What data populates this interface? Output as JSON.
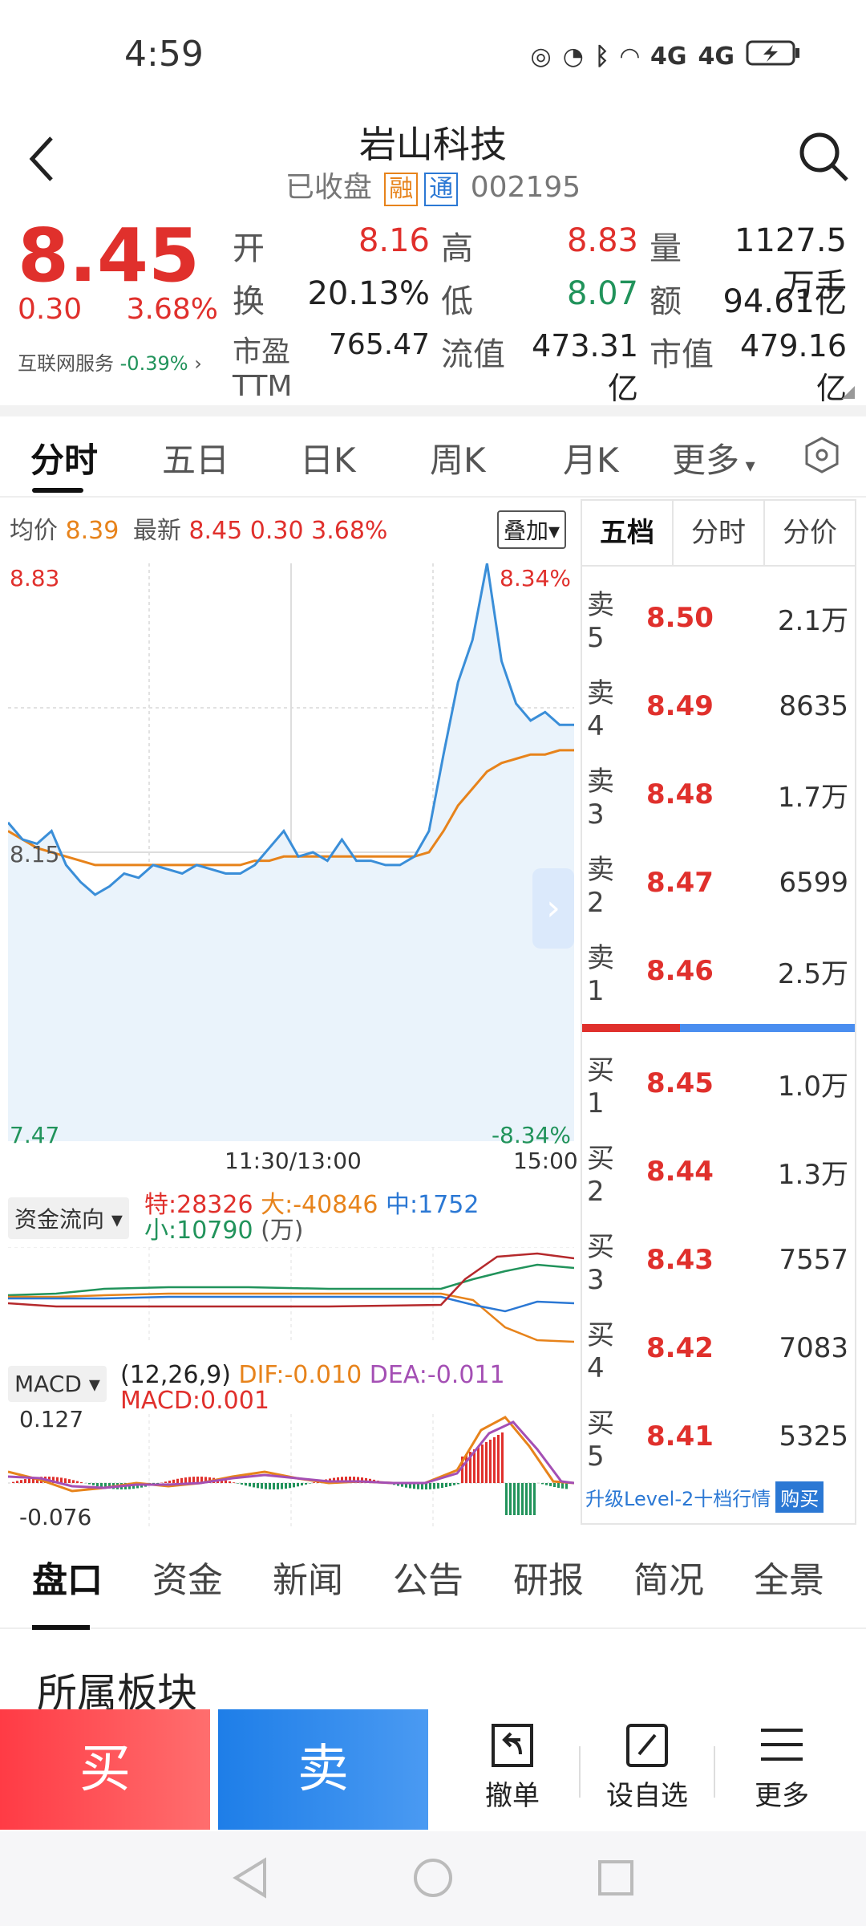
{
  "status": {
    "time": "4:59",
    "net1": "4G",
    "net2": "4G"
  },
  "header": {
    "title": "岩山科技",
    "state": "已收盘",
    "tag1": "融",
    "tag2": "通",
    "code": "002195"
  },
  "quote": {
    "price": "8.45",
    "change": "0.30",
    "change_pct": "3.68%",
    "sector_label": "互联网服务",
    "sector_pct": "-0.39%",
    "fields": [
      [
        {
          "label": "开",
          "value": "8.16",
          "color": "red"
        },
        {
          "label": "高",
          "value": "8.83",
          "color": "red"
        },
        {
          "label": "量",
          "value": "1127.5万手",
          "color": "dark"
        }
      ],
      [
        {
          "label": "换",
          "value": "20.13%",
          "color": "dark"
        },
        {
          "label": "低",
          "value": "8.07",
          "color": "green"
        },
        {
          "label": "额",
          "value": "94.61亿",
          "color": "dark"
        }
      ],
      [
        {
          "label": "市盈TTM",
          "value": "765.47",
          "color": "dark"
        },
        {
          "label": "流值",
          "value": "473.31亿",
          "color": "dark"
        },
        {
          "label": "市值",
          "value": "479.16亿",
          "color": "dark"
        }
      ]
    ]
  },
  "tabs": [
    "分时",
    "五日",
    "日K",
    "周K",
    "月K",
    "更多"
  ],
  "chart": {
    "legend": {
      "avg_label": "均价",
      "avg": "8.39",
      "latest_label": "最新",
      "latest": "8.45",
      "chg": "0.30",
      "pct": "3.68%"
    },
    "overlay_label": "叠加",
    "y_top": "8.83",
    "y_mid": "8.15",
    "y_bot": "7.47",
    "pct_top": "8.34%",
    "pct_bot": "-8.34%",
    "time_mid": "11:30/13:00",
    "time_end": "15:00"
  },
  "chart_data": {
    "type": "line",
    "series": [
      {
        "values": [
          8.22,
          8.18,
          8.17,
          8.2,
          8.12,
          8.08,
          8.05,
          8.07,
          8.1,
          8.09,
          8.12,
          8.11,
          8.1,
          8.12,
          8.11,
          8.1,
          8.1,
          8.12,
          8.16,
          8.2,
          8.14,
          8.15,
          8.13,
          8.18,
          8.13,
          8.13,
          8.12,
          8.12,
          8.14,
          8.2,
          8.38,
          8.55,
          8.65,
          8.83,
          8.6,
          8.5,
          8.46,
          8.48,
          8.45,
          8.45
        ]
      },
      {
        "values": [
          8.2,
          8.18,
          8.16,
          8.15,
          8.14,
          8.13,
          8.12,
          8.12,
          8.12,
          8.12,
          8.12,
          8.12,
          8.12,
          8.12,
          8.12,
          8.12,
          8.12,
          8.13,
          8.13,
          8.14,
          8.14,
          8.14,
          8.14,
          8.14,
          8.14,
          8.14,
          8.14,
          8.14,
          8.14,
          8.15,
          8.2,
          8.26,
          8.3,
          8.34,
          8.36,
          8.37,
          8.38,
          8.38,
          8.39,
          8.39
        ]
      }
    ],
    "ylim": [
      7.47,
      8.83
    ]
  },
  "fundflow": {
    "label": "资金流向",
    "te": "特:28326",
    "da": "大:-40846",
    "zhong": "中:1752",
    "xiao": "小:10790",
    "unit": "(万)"
  },
  "macd": {
    "label": "MACD",
    "params": "(12,26,9)",
    "dif": "DIF:-0.010",
    "dea": "DEA:-0.011",
    "macd": "MACD:0.001",
    "top": "0.127",
    "bot": "-0.076"
  },
  "orderbook": {
    "tabs": [
      "五档",
      "分时",
      "分价"
    ],
    "sells": [
      {
        "label": "卖5",
        "price": "8.50",
        "vol": "2.1万"
      },
      {
        "label": "卖4",
        "price": "8.49",
        "vol": "8635"
      },
      {
        "label": "卖3",
        "price": "8.48",
        "vol": "1.7万"
      },
      {
        "label": "卖2",
        "price": "8.47",
        "vol": "6599"
      },
      {
        "label": "卖1",
        "price": "8.46",
        "vol": "2.5万"
      }
    ],
    "buys": [
      {
        "label": "买1",
        "price": "8.45",
        "vol": "1.0万"
      },
      {
        "label": "买2",
        "price": "8.44",
        "vol": "1.3万"
      },
      {
        "label": "买3",
        "price": "8.43",
        "vol": "7557"
      },
      {
        "label": "买4",
        "price": "8.42",
        "vol": "7083"
      },
      {
        "label": "买5",
        "price": "8.41",
        "vol": "5325"
      }
    ],
    "upgrade": "升级Level-2十档行情",
    "buy_tag": "购买"
  },
  "bottom_tabs": [
    "盘口",
    "资金",
    "新闻",
    "公告",
    "研报",
    "简况",
    "全景"
  ],
  "section_title": "所属板块",
  "actions": {
    "buy": "买",
    "sell": "卖",
    "cancel": "撤单",
    "watch": "设自选",
    "more": "更多"
  }
}
